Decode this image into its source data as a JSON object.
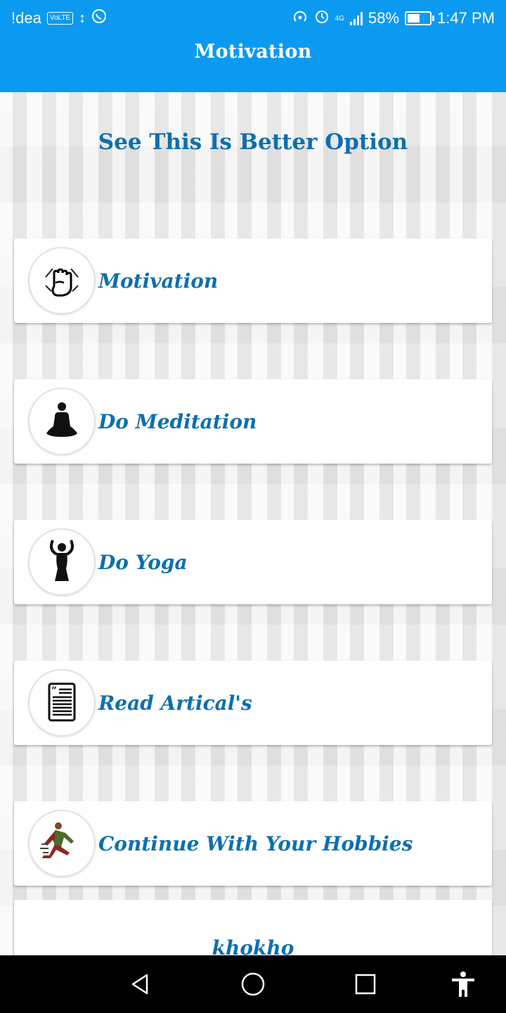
{
  "status_bar": {
    "carrier": "!dea",
    "volte": "VoLTE",
    "network": "4G",
    "battery_percent": "58%",
    "battery_level": 0.58,
    "time": "1:47 PM",
    "icons_left": [
      "usb-icon",
      "whatsapp-icon"
    ],
    "icons_right": [
      "hotspot-icon",
      "alarm-icon",
      "signal-icon",
      "battery-icon"
    ]
  },
  "app_bar": {
    "title": "Motivation",
    "color": "#0b9af0"
  },
  "main": {
    "heading": "See This Is Better Option",
    "accent_color": "#0d6fae",
    "options": [
      {
        "label": "Motivation",
        "icon": "raised-fist-icon"
      },
      {
        "label": "Do Meditation",
        "icon": "meditation-icon"
      },
      {
        "label": "Do Yoga",
        "icon": "yoga-pose-icon"
      },
      {
        "label": "Read Artical's",
        "icon": "article-icon"
      },
      {
        "label": "Continue With Your Hobbies",
        "icon": "running-person-icon"
      },
      {
        "label": "khokho",
        "icon": ""
      }
    ]
  },
  "nav_bar": {
    "buttons": [
      "back-icon",
      "home-icon",
      "recents-icon",
      "accessibility-icon"
    ]
  }
}
